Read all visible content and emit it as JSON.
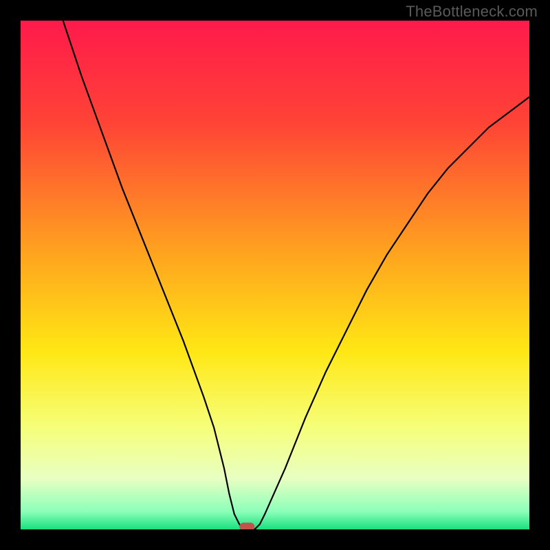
{
  "watermark": "TheBottleneck.com",
  "colors": {
    "frame": "#000000",
    "gradient_stops": [
      {
        "offset": 0.0,
        "color": "#ff1a4b"
      },
      {
        "offset": 0.2,
        "color": "#ff4336"
      },
      {
        "offset": 0.45,
        "color": "#ffa11f"
      },
      {
        "offset": 0.65,
        "color": "#ffe714"
      },
      {
        "offset": 0.8,
        "color": "#f6ff7a"
      },
      {
        "offset": 0.9,
        "color": "#e8ffc2"
      },
      {
        "offset": 0.965,
        "color": "#8cffb9"
      },
      {
        "offset": 1.0,
        "color": "#18e07e"
      }
    ],
    "curve": "#000000",
    "marker": "#c0544d"
  },
  "chart_data": {
    "type": "line",
    "title": "",
    "xlabel": "",
    "ylabel": "",
    "xlim": [
      0,
      100
    ],
    "ylim": [
      0,
      100
    ],
    "x": [
      0,
      4,
      8,
      12,
      16,
      20,
      24,
      28,
      32,
      36,
      38,
      40,
      41,
      42,
      43,
      44,
      45,
      46,
      47,
      48,
      52,
      56,
      60,
      64,
      68,
      72,
      76,
      80,
      84,
      88,
      92,
      96,
      100
    ],
    "values": [
      128,
      114,
      101,
      89,
      78,
      67,
      57,
      47,
      37,
      26,
      20,
      12,
      7,
      3,
      1,
      0,
      0,
      0,
      1,
      3,
      12,
      22,
      31,
      39,
      47,
      54,
      60,
      66,
      71,
      75,
      79,
      82,
      85
    ],
    "notes": "Single V-shaped curve. y expressed as approximate percent of plot height from bottom; values above 100 indicate the curve extends above the visible top edge. Minimum near x≈44–46 where y≈0.",
    "marker": {
      "x": 44.5,
      "y": 0.5,
      "shape": "rounded-rect"
    }
  }
}
